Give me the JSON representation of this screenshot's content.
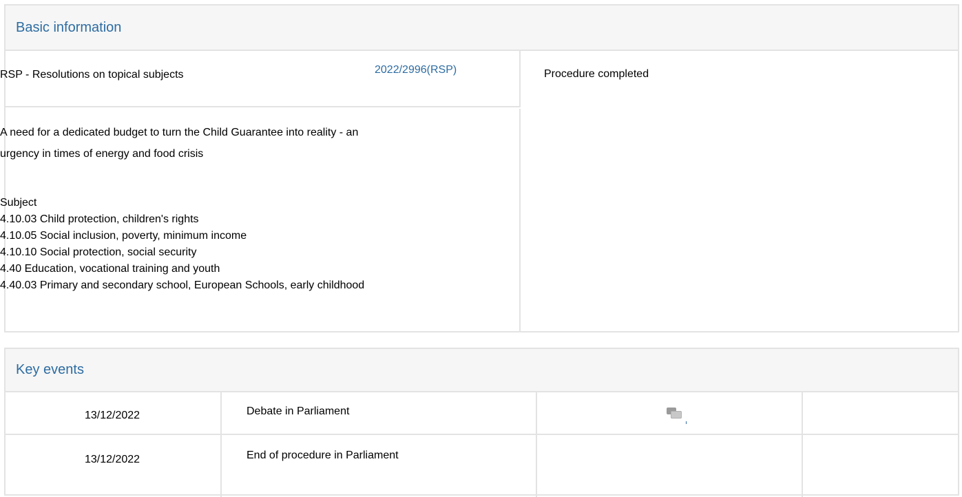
{
  "basic": {
    "header": "Basic information",
    "procedure_type": "RSP - Resolutions on topical subjects",
    "reference": "2022/2996(RSP)",
    "status": "Procedure completed",
    "title_line1": "A need for a dedicated budget to turn the Child Guarantee into reality - an",
    "title_line2": "urgency in times of energy and food crisis",
    "subject_label": "Subject",
    "subjects": [
      "4.10.03 Child protection, children's rights",
      "4.10.05 Social inclusion, poverty, minimum income",
      "4.10.10 Social protection, social security",
      "4.40 Education, vocational training and youth",
      "4.40.03 Primary and secondary school, European Schools, early childhood"
    ]
  },
  "events": {
    "header": "Key events",
    "rows": [
      {
        "date": "13/12/2022",
        "event": "Debate in Parliament",
        "icon": "debate-icon"
      },
      {
        "date": "13/12/2022",
        "event": "End of procedure in Parliament"
      }
    ]
  },
  "colors": {
    "header_text": "#2d6ca2",
    "header_bg": "#f6f6f6",
    "border": "#e3e3e3",
    "link": "#2d6ca2"
  }
}
